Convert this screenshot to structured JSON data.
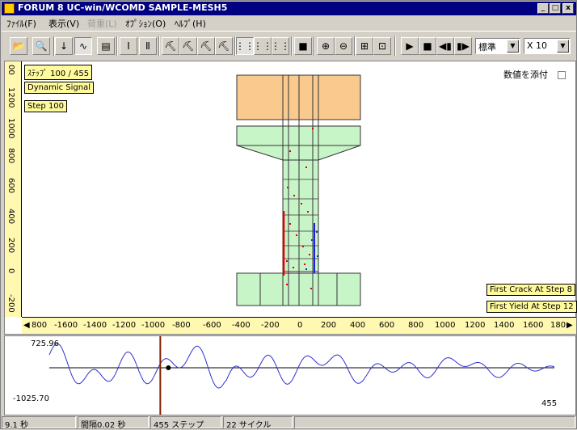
{
  "window": {
    "title": "FORUM 8    UC-win/WCOMD    SAMPLE-MESH5",
    "caption_buttons": [
      "_",
      "□",
      "x"
    ]
  },
  "menu": [
    {
      "label": "ﾌｧｲﾙ(F)",
      "disabled": false
    },
    {
      "label": "表示(V)",
      "disabled": false
    },
    {
      "label": "荷重(L)",
      "disabled": true
    },
    {
      "label": "ｵﾌﾟｼｮﾝ(O)",
      "disabled": false
    },
    {
      "label": "ﾍﾙﾌﾟ(H)",
      "disabled": false
    }
  ],
  "toolbar": {
    "icons": [
      "open-icon",
      "zoom-page-icon",
      "down-arrow-icon",
      "signal-icon",
      "picture-icon",
      "beam-icon",
      "beam2-icon",
      "crane1-icon",
      "crane2-icon",
      "crane3-icon",
      "crane4-icon",
      "mesh-fine-icon",
      "mesh-medium-icon",
      "mesh-coarse-icon",
      "cube-icon",
      "zoom-in-icon",
      "zoom-out-icon",
      "fit-icon",
      "frame-icon",
      "play-icon",
      "stop-icon",
      "step-back-icon",
      "step-forward-icon"
    ],
    "glyphs": [
      "📂",
      "🔍",
      "↓",
      "∿",
      "▤",
      "Ⅰ",
      "Ⅱ",
      "⛏",
      "⛏",
      "⛏",
      "⛏",
      "⋮⋮",
      "⋮⋮",
      "⋮⋮",
      "■",
      "⊕",
      "⊖",
      "⊞",
      "⊡",
      "▶",
      "■",
      "◀▮",
      "▮▶"
    ],
    "speed_value": "標準",
    "scale_value": "X 10"
  },
  "canvas": {
    "labels": {
      "step": "ｽﾃｯﾌﾟ 100 / 455",
      "signal": "Dynamic Signal",
      "step_short": "Step 100",
      "first_crack": "First Crack At Step 8",
      "first_yield": "First Yield At Step 12"
    },
    "attach_values_label": "数値を添付",
    "vertical_ruler_ticks": [
      "00",
      "1200",
      "1000",
      "800",
      "600",
      "400",
      "200",
      "0",
      "-200"
    ],
    "horizontal_ruler_ticks": [
      "800",
      "-1600",
      "-1400",
      "-1200",
      "-1000",
      "-800",
      "-600",
      "-400",
      "-200",
      "0",
      "200",
      "400",
      "600",
      "800",
      "1000",
      "1200",
      "1400",
      "1600",
      "180"
    ],
    "colors": {
      "footing_top": "#f9c98d",
      "body": "#c8f5c8",
      "ruler": "#fff8b0",
      "tag": "#fffb9c",
      "red_crack": "#e00000",
      "blue_crack": "#2020e0"
    }
  },
  "wave": {
    "max_label": "725.96",
    "min_label": "-1025.70",
    "end_step": "455",
    "current_step": 100,
    "total_steps": 455,
    "line_color": "#3030d0",
    "cursor_color": "#802000"
  },
  "status": {
    "time": "9.1 秒",
    "interval": "間隔0.02 秒",
    "steps": "455 ステップ",
    "cycles": "22 サイクル"
  }
}
